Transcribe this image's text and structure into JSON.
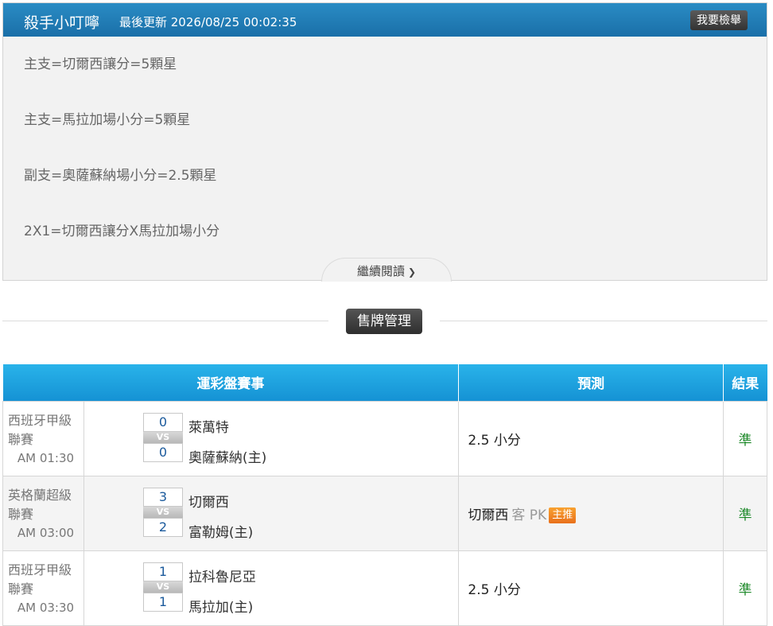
{
  "header": {
    "title": "殺手小叮嚀",
    "update": "最後更新 2026/08/25 00:02:35",
    "report_label": "我要檢舉"
  },
  "content": {
    "lines": [
      "主支=切爾西讓分=5顆星",
      "主支=馬拉加場小分=5顆星",
      "副支=奧薩蘇納場小分=2.5顆星",
      "2X1=切爾西讓分X馬拉加場小分"
    ],
    "read_more": "繼續閱讀"
  },
  "badge": "售牌管理",
  "table": {
    "headers": [
      "運彩盤賽事",
      "預測",
      "結果"
    ],
    "vs_label": "VS",
    "rows": [
      {
        "league": "西班牙甲級聯賽",
        "time": "AM 01:30",
        "away_score": "0",
        "home_score": "0",
        "away_team": "萊萬特",
        "home_team": "奧薩蘇納(主)",
        "prediction": "2.5 小分",
        "prediction_extra": "",
        "tag": "",
        "result": "準"
      },
      {
        "league": "英格蘭超級聯賽",
        "time": "AM 03:00",
        "away_score": "3",
        "home_score": "2",
        "away_team": "切爾西",
        "home_team": "富勒姆(主)",
        "prediction": "切爾西",
        "prediction_extra": "客 PK",
        "tag": "主推",
        "result": "準"
      },
      {
        "league": "西班牙甲級聯賽",
        "time": "AM 03:30",
        "away_score": "1",
        "home_score": "1",
        "away_team": "拉科魯尼亞",
        "home_team": "馬拉加(主)",
        "prediction": "2.5 小分",
        "prediction_extra": "",
        "tag": "",
        "result": "準"
      }
    ]
  }
}
